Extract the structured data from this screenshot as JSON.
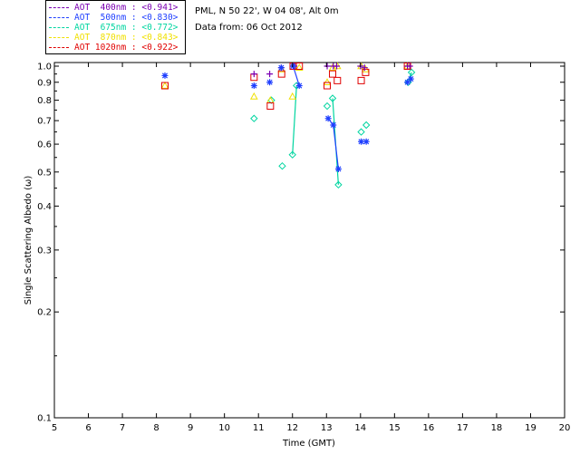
{
  "info": {
    "site_line": "PML, N 50 22', W 04 08', Alt 0m",
    "date_line": "Data from: 06 Oct 2012"
  },
  "legend": [
    {
      "text": "AOT  400nm : <0.941>",
      "color": "#7b00b3"
    },
    {
      "text": "AOT  500nm : <0.830>",
      "color": "#1f3fff"
    },
    {
      "text": "AOT  675nm : <0.772>",
      "color": "#00d5a0"
    },
    {
      "text": "AOT  870nm : <0.843>",
      "color": "#f0e000"
    },
    {
      "text": "AOT 1020nm : <0.922>",
      "color": "#e00000"
    }
  ],
  "chart_data": {
    "type": "scatter",
    "title": "",
    "xlabel": "Time (GMT)",
    "ylabel": "Single Scattering Albedo (ω)",
    "xlim": [
      5,
      20
    ],
    "ylim": [
      0.1,
      1.0
    ],
    "yscale": "log",
    "grid": false,
    "legend_position": "top-left",
    "x_ticks": [
      5,
      6,
      7,
      8,
      9,
      10,
      11,
      12,
      13,
      14,
      15,
      16,
      17,
      18,
      19,
      20
    ],
    "x_tick_labels": [
      "5",
      "6",
      "7",
      "8",
      "9",
      "10",
      "11",
      "12",
      "13",
      "14",
      "15",
      "16",
      "17",
      "18",
      "19",
      "20"
    ],
    "y_ticks": [
      0.1,
      0.2,
      0.3,
      0.4,
      0.5,
      0.6,
      0.7,
      0.8,
      0.9,
      1.0
    ],
    "y_tick_labels": [
      "0.1",
      "0.2",
      "0.3",
      "0.4",
      "0.5",
      "0.6",
      "0.7",
      "0.8",
      "0.9",
      "1.0"
    ],
    "series": [
      {
        "name": "AOT  400nm : <0.941>",
        "color": "#7b00b3",
        "marker": "plus",
        "x": [
          10.87,
          11.33,
          11.67,
          12.02,
          12.05,
          13.02,
          13.2,
          13.3,
          14.0,
          14.12,
          15.38,
          15.45
        ],
        "y": [
          0.95,
          0.95,
          0.99,
          1.0,
          1.0,
          1.0,
          1.0,
          1.0,
          1.0,
          0.99,
          1.0,
          1.0
        ]
      },
      {
        "name": "AOT  500nm : <0.830>",
        "color": "#1f3fff",
        "marker": "asterisk",
        "x": [
          8.25,
          10.87,
          11.33,
          11.67,
          12.02,
          12.2,
          13.05,
          13.2,
          13.35,
          14.02,
          14.17,
          15.38,
          15.48
        ],
        "y": [
          0.94,
          0.88,
          0.9,
          0.99,
          1.0,
          0.88,
          0.71,
          0.68,
          0.51,
          0.61,
          0.61,
          0.9,
          0.92
        ]
      },
      {
        "name": "AOT  675nm : <0.772>",
        "color": "#00d5a0",
        "marker": "diamond",
        "x": [
          10.87,
          11.38,
          11.7,
          12.0,
          12.12,
          13.02,
          13.18,
          13.35,
          14.02,
          14.17,
          15.4,
          15.5
        ],
        "y": [
          0.71,
          0.8,
          0.52,
          0.56,
          0.88,
          0.77,
          0.81,
          0.46,
          0.65,
          0.68,
          0.9,
          0.96
        ]
      },
      {
        "name": "AOT  870nm : <0.843>",
        "color": "#f0e000",
        "marker": "triangle",
        "x": [
          8.25,
          10.87,
          11.35,
          11.68,
          12.0,
          12.2,
          13.02,
          13.18,
          13.32,
          14.02,
          14.15,
          15.38
        ],
        "y": [
          0.88,
          0.82,
          0.8,
          0.98,
          0.82,
          0.99,
          0.9,
          0.99,
          1.0,
          1.0,
          0.98,
          1.0
        ]
      },
      {
        "name": "AOT 1020nm : <0.922>",
        "color": "#e00000",
        "marker": "square",
        "x": [
          8.25,
          10.87,
          11.35,
          11.68,
          12.02,
          12.2,
          13.02,
          13.18,
          13.32,
          14.02,
          14.15,
          15.38
        ],
        "y": [
          0.88,
          0.93,
          0.77,
          0.95,
          1.0,
          1.0,
          0.88,
          0.95,
          0.91,
          0.91,
          0.96,
          1.0
        ]
      }
    ],
    "connecting_lines": [
      {
        "color": "#00d5a0",
        "x": [
          12.0,
          12.12
        ],
        "y": [
          0.56,
          0.88
        ]
      },
      {
        "color": "#00d5a0",
        "x": [
          13.18,
          13.35
        ],
        "y": [
          0.81,
          0.46
        ]
      },
      {
        "color": "#00d5a0",
        "x": [
          15.4,
          15.5
        ],
        "y": [
          0.9,
          0.96
        ]
      },
      {
        "color": "#1f3fff",
        "x": [
          13.05,
          13.2,
          13.35
        ],
        "y": [
          0.71,
          0.68,
          0.51
        ]
      },
      {
        "color": "#1f3fff",
        "x": [
          12.02,
          12.2
        ],
        "y": [
          1.0,
          0.88
        ]
      }
    ]
  }
}
